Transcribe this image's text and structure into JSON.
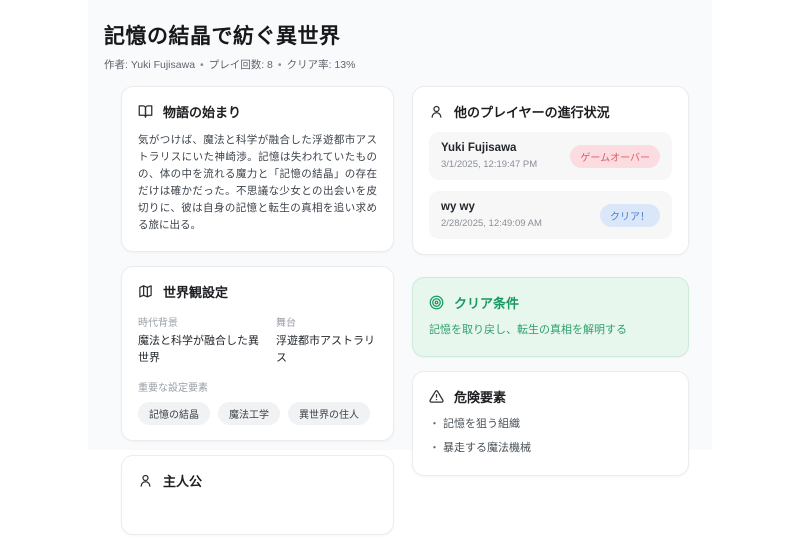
{
  "header": {
    "title": "記憶の結晶で紡ぐ異世界",
    "meta_parts": [
      "作者: Yuki Fujisawa",
      "プレイ回数: 8",
      "クリア率: 13%"
    ],
    "separator": "•"
  },
  "story": {
    "title": "物語の始まり",
    "icon": "book-open-icon",
    "body": "気がつけば、魔法と科学が融合した浮遊都市アストラリスにいた神崎渉。記憶は失われていたものの、体の中を流れる魔力と「記憶の結晶」の存在だけは確かだった。不思議な少女との出会いを皮切りに、彼は自身の記憶と転生の真相を追い求める旅に出る。"
  },
  "world": {
    "title": "世界観設定",
    "icon": "map-icon",
    "fields": [
      {
        "label": "時代背景",
        "value": "魔法と科学が融合した異世界"
      },
      {
        "label": "舞台",
        "value": "浮遊都市アストラリス"
      }
    ],
    "elements_label": "重要な設定要素",
    "tags": [
      "記憶の結晶",
      "魔法工学",
      "異世界の住人"
    ]
  },
  "protagonist": {
    "title": "主人公",
    "icon": "user-icon"
  },
  "players": {
    "title": "他のプレイヤーの進行状況",
    "icon": "user-icon",
    "rows": [
      {
        "name": "Yuki Fujisawa",
        "datetime": "3/1/2025, 12:19:47 PM",
        "badge": "ゲームオーバー",
        "badge_type": "gameover"
      },
      {
        "name": "wy wy",
        "datetime": "2/28/2025, 12:49:09 AM",
        "badge": "クリア！",
        "badge_type": "clear"
      }
    ]
  },
  "clear_condition": {
    "title": "クリア条件",
    "icon": "target-icon",
    "text": "記憶を取り戻し、転生の真相を解明する"
  },
  "danger": {
    "title": "危険要素",
    "icon": "alert-triangle-icon",
    "bullet": "・",
    "items": [
      "記憶を狙う組織",
      "暴走する魔法機械"
    ]
  },
  "colors": {
    "content_bg": "#f9fafb",
    "card_bg": "#ffffff",
    "green_bg": "#e8f7ee",
    "green_text": "#17995f",
    "badge_gameover_bg": "#fbdce1",
    "badge_gameover_text": "#df5a66",
    "badge_clear_bg": "#d9e7f9",
    "badge_clear_text": "#4a80d6"
  }
}
